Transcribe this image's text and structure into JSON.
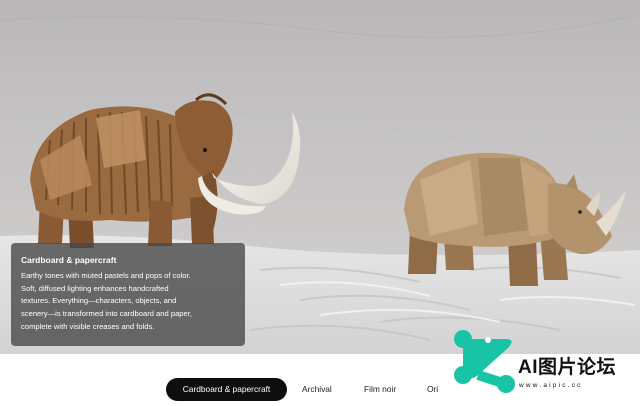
{
  "caption": {
    "title": "Cardboard & papercraft",
    "lines": [
      "Earthy tones with muted pastels and pops of color.",
      "Soft, diffused lighting enhances handcrafted",
      "textures. Everything—characters, objects, and",
      "scenery—is transformed into cardboard and paper,",
      "complete with visible creases and folds."
    ]
  },
  "tabs": [
    {
      "label": "Cardboard & papercraft",
      "active": true
    },
    {
      "label": "Archival",
      "active": false
    },
    {
      "label": "Film noir",
      "active": false
    },
    {
      "label": "Ori",
      "active": false
    }
  ],
  "watermark": {
    "text": "AI图片论坛",
    "url": "www.aipic.cc",
    "logo_color": "#19c3a6"
  },
  "scene": {
    "subjects": [
      "papercraft-mammoth",
      "papercraft-rhinoceros"
    ]
  }
}
